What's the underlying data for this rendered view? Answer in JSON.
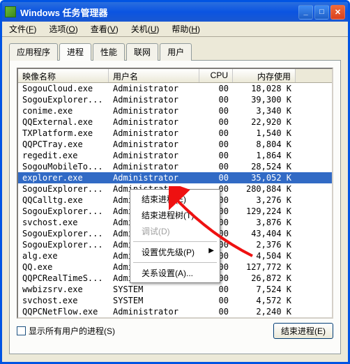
{
  "window": {
    "title": "Windows 任务管理器"
  },
  "menubar": [
    {
      "label": "文件",
      "hot": "F"
    },
    {
      "label": "选项",
      "hot": "O"
    },
    {
      "label": "查看",
      "hot": "V"
    },
    {
      "label": "关机",
      "hot": "U"
    },
    {
      "label": "帮助",
      "hot": "H"
    }
  ],
  "tabs": {
    "items": [
      "应用程序",
      "进程",
      "性能",
      "联网",
      "用户"
    ],
    "active": 1
  },
  "columns": {
    "name": "映像名称",
    "user": "用户名",
    "cpu": "CPU",
    "mem": "内存使用"
  },
  "processes": [
    {
      "name": "SogouCloud.exe",
      "user": "Administrator",
      "cpu": "00",
      "mem": "18,028 K",
      "sel": false
    },
    {
      "name": "SogouExplorer...",
      "user": "Administrator",
      "cpu": "00",
      "mem": "39,300 K",
      "sel": false
    },
    {
      "name": "conime.exe",
      "user": "Administrator",
      "cpu": "00",
      "mem": "3,340 K",
      "sel": false
    },
    {
      "name": "QQExternal.exe",
      "user": "Administrator",
      "cpu": "00",
      "mem": "22,920 K",
      "sel": false
    },
    {
      "name": "TXPlatform.exe",
      "user": "Administrator",
      "cpu": "00",
      "mem": "1,540 K",
      "sel": false
    },
    {
      "name": "QQPCTray.exe",
      "user": "Administrator",
      "cpu": "00",
      "mem": "8,804 K",
      "sel": false
    },
    {
      "name": "regedit.exe",
      "user": "Administrator",
      "cpu": "00",
      "mem": "1,864 K",
      "sel": false
    },
    {
      "name": "SogouMobileTo...",
      "user": "Administrator",
      "cpu": "00",
      "mem": "28,524 K",
      "sel": false
    },
    {
      "name": "explorer.exe",
      "user": "Administrator",
      "cpu": "00",
      "mem": "35,052 K",
      "sel": true
    },
    {
      "name": "SogouExplorer...",
      "user": "Administrator",
      "cpu": "00",
      "mem": "280,884 K",
      "sel": false
    },
    {
      "name": "QQCalltg.exe",
      "user": "Administrator",
      "cpu": "00",
      "mem": "3,276 K",
      "sel": false
    },
    {
      "name": "SogouExplorer...",
      "user": "Administrator",
      "cpu": "00",
      "mem": "129,224 K",
      "sel": false
    },
    {
      "name": "svchost.exe",
      "user": "Administrator",
      "cpu": "00",
      "mem": "3,876 K",
      "sel": false
    },
    {
      "name": "SogouExplorer...",
      "user": "Administrator",
      "cpu": "00",
      "mem": "43,404 K",
      "sel": false
    },
    {
      "name": "SogouExplorer...",
      "user": "Administrator",
      "cpu": "00",
      "mem": "2,376 K",
      "sel": false
    },
    {
      "name": "alg.exe",
      "user": "Administrator",
      "cpu": "00",
      "mem": "4,504 K",
      "sel": false
    },
    {
      "name": "QQ.exe",
      "user": "Administrator",
      "cpu": "00",
      "mem": "127,772 K",
      "sel": false
    },
    {
      "name": "QQPCRealTimeS...",
      "user": "Administrator",
      "cpu": "00",
      "mem": "26,872 K",
      "sel": false
    },
    {
      "name": "wwbizsrv.exe",
      "user": "SYSTEM",
      "cpu": "00",
      "mem": "7,524 K",
      "sel": false
    },
    {
      "name": "svchost.exe",
      "user": "SYSTEM",
      "cpu": "00",
      "mem": "4,572 K",
      "sel": false
    },
    {
      "name": "QQPCNetFlow.exe",
      "user": "Administrator",
      "cpu": "00",
      "mem": "2,240 K",
      "sel": false
    }
  ],
  "context_menu": {
    "items": [
      {
        "label": "结束进程(E)",
        "type": "item"
      },
      {
        "label": "结束进程树(T)",
        "type": "item"
      },
      {
        "label": "调试(D)",
        "type": "disabled"
      },
      {
        "type": "sep"
      },
      {
        "label": "设置优先级(P)",
        "type": "submenu"
      },
      {
        "type": "sep"
      },
      {
        "label": "关系设置(A)...",
        "type": "item"
      }
    ]
  },
  "footer": {
    "show_all": "显示所有用户的进程(S)",
    "end_process": "结束进程(E)"
  }
}
